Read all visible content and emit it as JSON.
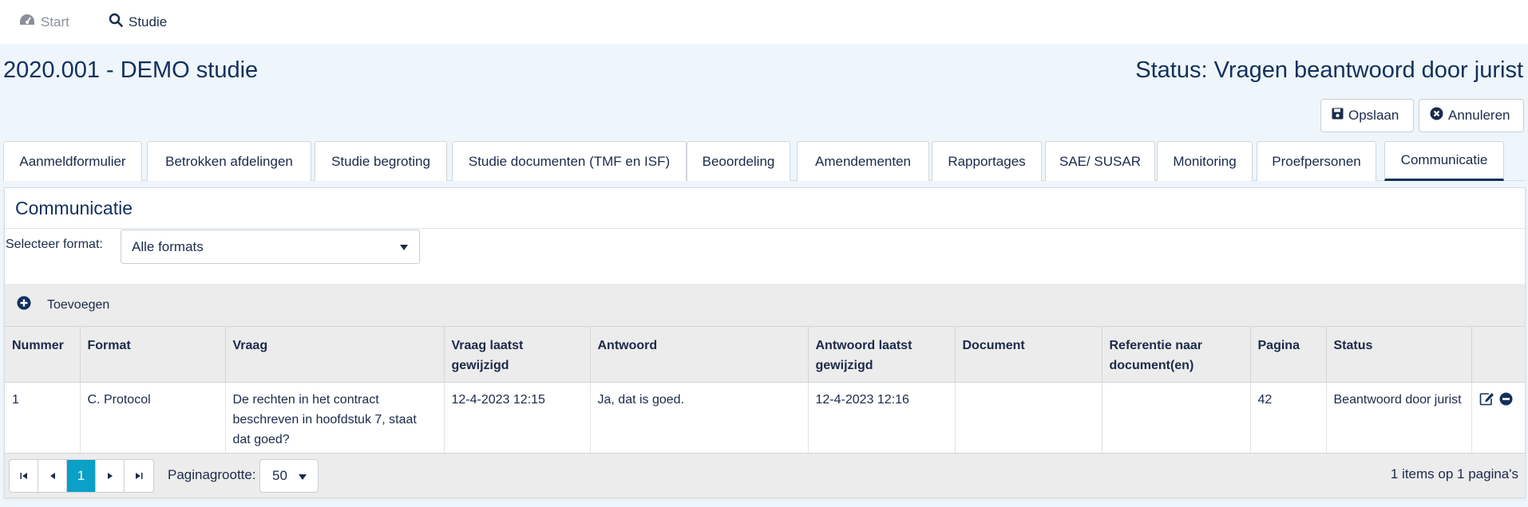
{
  "nav": {
    "start_label": "Start",
    "studie_label": "Studie"
  },
  "header": {
    "title": "2020.001 - DEMO studie",
    "status": "Status: Vragen beantwoord door jurist"
  },
  "actions": {
    "save_label": "Opslaan",
    "cancel_label": "Annuleren"
  },
  "tabs": [
    {
      "label": "Aanmeldformulier"
    },
    {
      "label": "Betrokken afdelingen"
    },
    {
      "label": "Studie begroting"
    },
    {
      "label": "Studie documenten (TMF en ISF)"
    },
    {
      "label": "Beoordeling"
    },
    {
      "label": "Amendementen"
    },
    {
      "label": "Rapportages"
    },
    {
      "label": "SAE/ SUSAR"
    },
    {
      "label": "Monitoring"
    },
    {
      "label": "Proefpersonen"
    },
    {
      "label": "Communicatie"
    }
  ],
  "active_tab": "Communicatie",
  "panel": {
    "title": "Communicatie",
    "filter_label": "Selecteer format:",
    "filter_value": "Alle formats",
    "add_label": "Toevoegen"
  },
  "table": {
    "columns": [
      "Nummer",
      "Format",
      "Vraag",
      "Vraag laatst gewijzigd",
      "Antwoord",
      "Antwoord laatst gewijzigd",
      "Document",
      "Referentie naar document(en)",
      "Pagina",
      "Status",
      ""
    ],
    "rows": [
      {
        "nummer": "1",
        "format": "C. Protocol",
        "vraag": "De rechten in het contract beschreven in hoofdstuk 7, staat dat goed?",
        "vraag_gewijzigd": "12-4-2023 12:15",
        "antwoord": "Ja, dat is goed.",
        "antwoord_gewijzigd": "12-4-2023 12:16",
        "document": "",
        "referentie": "",
        "pagina": "42",
        "status": "Beantwoord door jurist"
      }
    ]
  },
  "pager": {
    "current_page": "1",
    "page_size_label": "Paginagrootte:",
    "page_size": "50",
    "info": "1 items op 1 pagina's"
  },
  "colors": {
    "background": "#eef6fc",
    "primary": "#12305c",
    "pager_active": "#0aa0c8"
  }
}
